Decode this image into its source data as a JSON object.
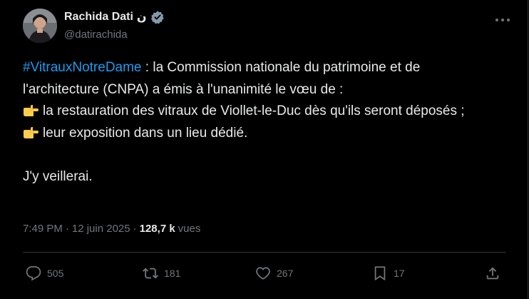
{
  "author": {
    "name": "Rachida Dati",
    "name_glyph": "ن",
    "handle": "@datirachida",
    "verified": true
  },
  "tweet": {
    "hashtag": "#VitrauxNotreDame",
    "line1_rest": " : la Commission nationale du patrimoine et de l'architecture (CNPA) a émis à l'unanimité le vœu de :",
    "bullet1": "la restauration des vitraux de Viollet-le-Duc dès qu'ils seront déposés ;",
    "bullet2": "leur exposition dans un lieu dédié.",
    "closing": "J'y veillerai.",
    "bullet_icon": "pointing-right-hand-emoji"
  },
  "meta": {
    "time": "7:49 PM",
    "separator": "·",
    "date": "12 juin 2025",
    "separator2": "·",
    "views_count": "128,7 k",
    "views_label": "vues"
  },
  "actions": {
    "replies": "505",
    "reposts": "181",
    "likes": "267",
    "bookmarks": "17"
  },
  "colors": {
    "background": "#000000",
    "text": "#e7e9ea",
    "muted": "#71767b",
    "link": "#1d9bf0",
    "divider": "#2f3336",
    "verified": "#829aab"
  }
}
